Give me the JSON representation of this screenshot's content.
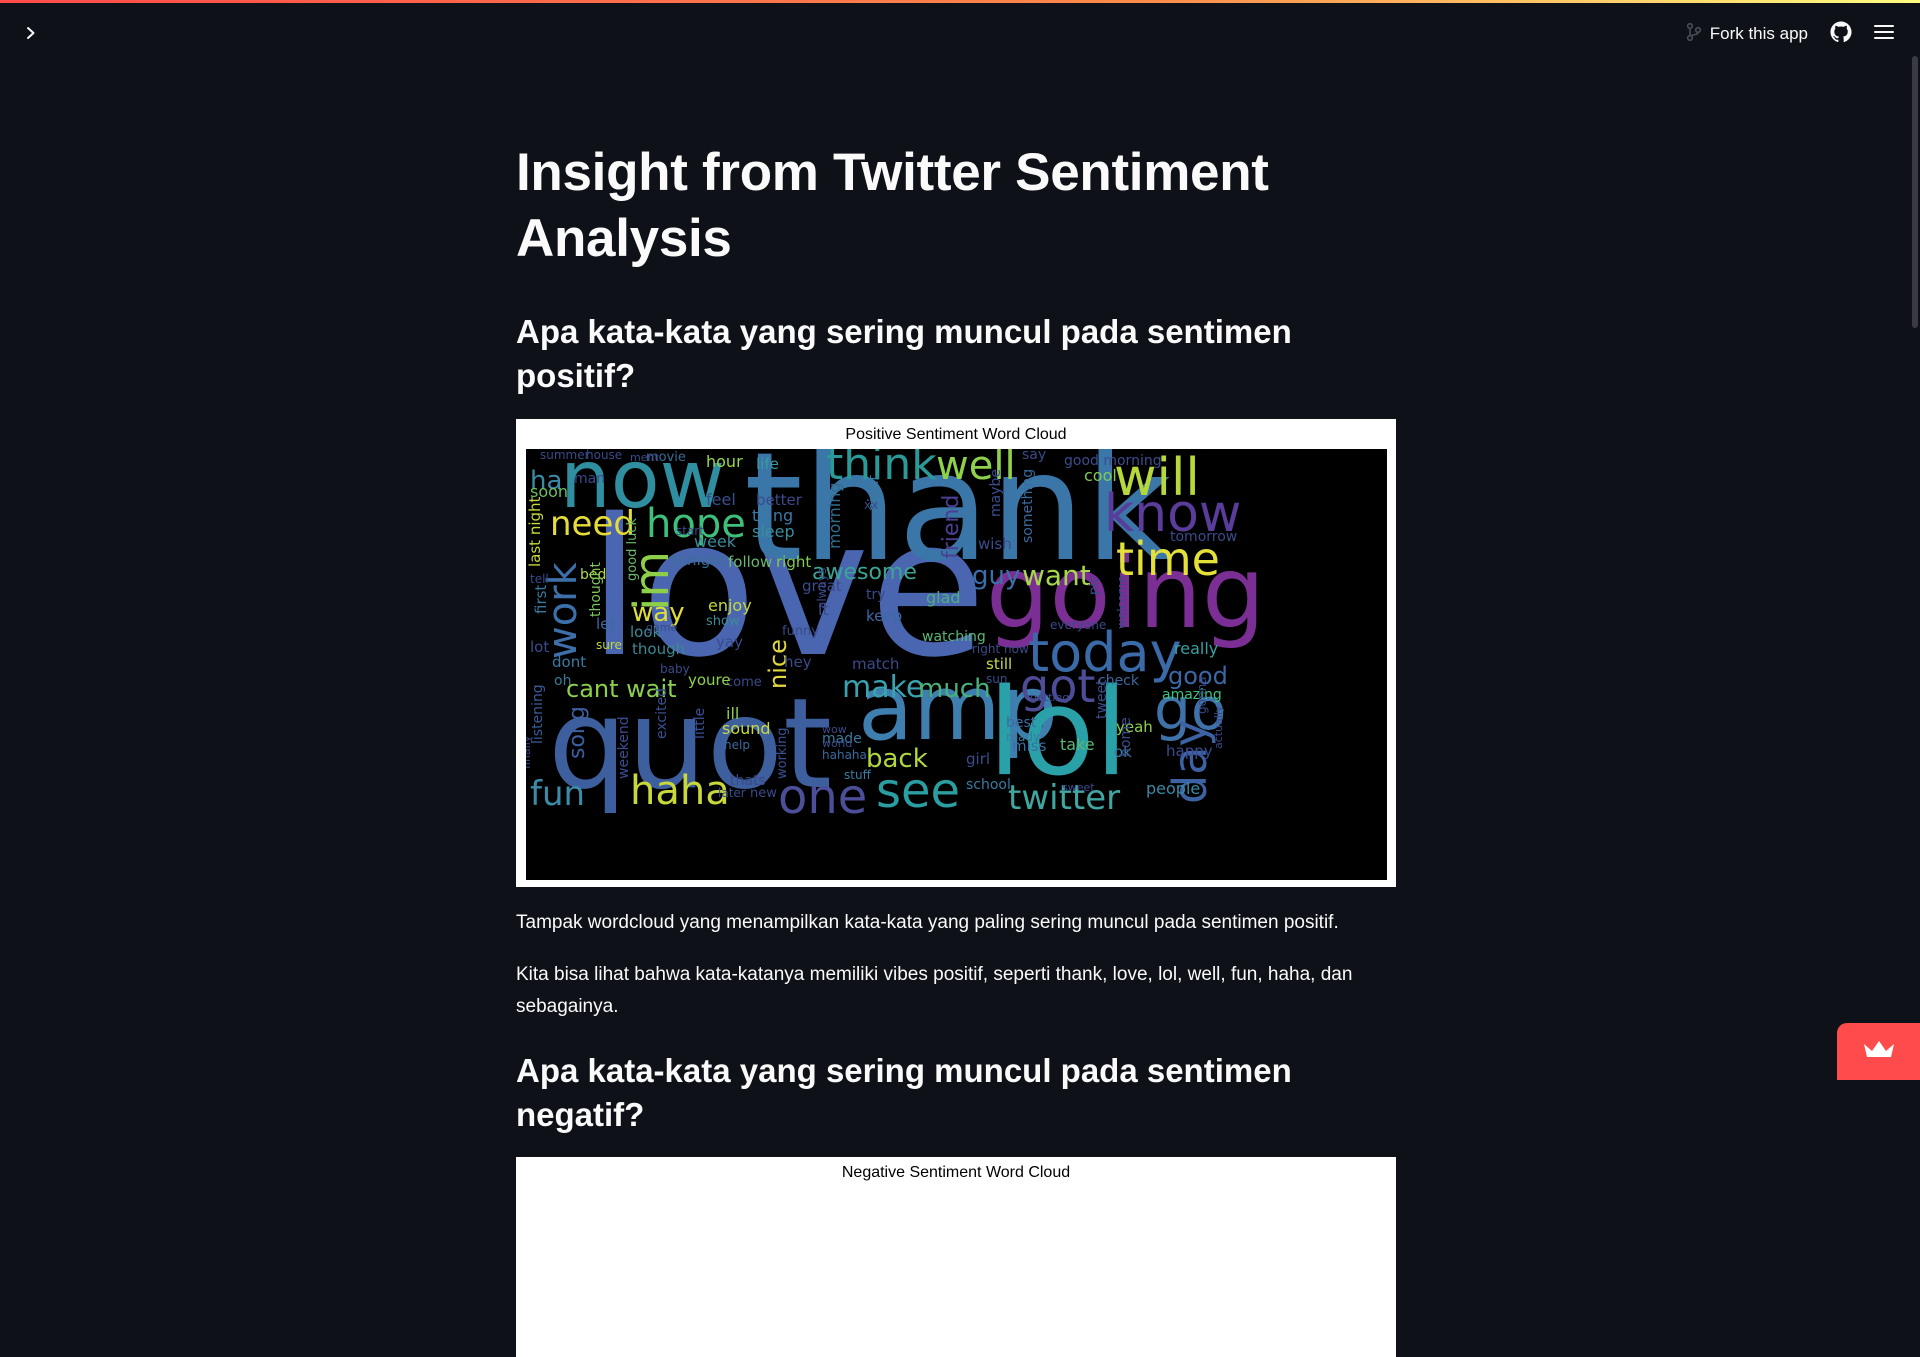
{
  "header": {
    "expand_icon": "chevron-right-icon",
    "fork_label": "Fork this app",
    "fork_icon": "fork-icon",
    "github_icon": "github-icon",
    "menu_icon": "hamburger-menu-icon"
  },
  "main": {
    "title": "Insight from Twitter Sentiment Analysis",
    "section_positive": {
      "heading": "Apa kata-kata yang sering muncul pada sentimen positif?",
      "figure_title": "Positive Sentiment Word Cloud",
      "paragraph_1": "Tampak wordcloud yang menampilkan kata-kata yang paling sering muncul pada sentimen positif.",
      "paragraph_2": "Kita bisa lihat bahwa kata-katanya memiliki vibes positif, seperti thank, love, lol, well, fun, haha, dan sebagainya."
    },
    "section_negative": {
      "heading": "Apa kata-kata yang sering muncul pada sentimen negatif?",
      "figure_title": "Negative Sentiment Word Cloud"
    }
  },
  "wordcloud_positive": [
    {
      "text": "love",
      "color": "#4a66b0"
    },
    {
      "text": "thank",
      "color": "#3b76a8"
    },
    {
      "text": "now",
      "color": "#2f8fa0"
    },
    {
      "text": "quot",
      "color": "#3e5f9e"
    },
    {
      "text": "amp",
      "color": "#3e7fb0"
    },
    {
      "text": "lol",
      "color": "#2aa0a8"
    },
    {
      "text": "going",
      "color": "#7b2f95"
    },
    {
      "text": "will",
      "color": "#b6d83a"
    },
    {
      "text": "know",
      "color": "#5a3c9a"
    },
    {
      "text": "time",
      "color": "#e3e03a"
    },
    {
      "text": "today",
      "color": "#3a6aa8"
    },
    {
      "text": "think",
      "color": "#2a9a98"
    },
    {
      "text": "well",
      "color": "#8ed14a"
    },
    {
      "text": "hope",
      "color": "#3ec07a"
    },
    {
      "text": "need",
      "color": "#e6dc38"
    },
    {
      "text": "work",
      "color": "#3d6fa8"
    },
    {
      "text": "im",
      "color": "#8ecf4a"
    },
    {
      "text": "go",
      "color": "#3f72a8"
    },
    {
      "text": "got",
      "color": "#4e4c96"
    },
    {
      "text": "see",
      "color": "#2a9ea0"
    },
    {
      "text": "one",
      "color": "#4c4e98"
    },
    {
      "text": "haha",
      "color": "#c8d83a"
    },
    {
      "text": "fun",
      "color": "#3a8aa8"
    },
    {
      "text": "twitter",
      "color": "#3fa6a0"
    },
    {
      "text": "day",
      "color": "#3d62a4"
    },
    {
      "text": "make",
      "color": "#3aa2b0"
    },
    {
      "text": "much",
      "color": "#4bb07a"
    },
    {
      "text": "back",
      "color": "#b0d640"
    },
    {
      "text": "want",
      "color": "#a8d848"
    },
    {
      "text": "awesome",
      "color": "#3ca494"
    },
    {
      "text": "cant wait",
      "color": "#8cd14e"
    },
    {
      "text": "way",
      "color": "#e0dc3a"
    },
    {
      "text": "nice",
      "color": "#e3d83a"
    },
    {
      "text": "good",
      "color": "#3b67a6"
    },
    {
      "text": "guy",
      "color": "#3a6fa8"
    },
    {
      "text": "friend",
      "color": "#4b3f92"
    },
    {
      "text": "song",
      "color": "#3b5fa0"
    },
    {
      "text": "hour",
      "color": "#9ad44a"
    },
    {
      "text": "feel",
      "color": "#3a4f8e"
    },
    {
      "text": "thing",
      "color": "#3a7aa6"
    },
    {
      "text": "sleep",
      "color": "#3a8e9e"
    },
    {
      "text": "week",
      "color": "#3d8a9a"
    },
    {
      "text": "morning",
      "color": "#2e6e8a"
    },
    {
      "text": "night",
      "color": "#3a7aa0"
    },
    {
      "text": "tonight",
      "color": "#3a7096"
    },
    {
      "text": "follow",
      "color": "#6ab86e"
    },
    {
      "text": "right",
      "color": "#7fcf50"
    },
    {
      "text": "enjoy",
      "color": "#c7d83d"
    },
    {
      "text": "show",
      "color": "#3c8a9a"
    },
    {
      "text": "sound",
      "color": "#c9d93a"
    },
    {
      "text": "really",
      "color": "#3aa0a0"
    },
    {
      "text": "still",
      "color": "#c8d84a"
    },
    {
      "text": "watching",
      "color": "#5ab874"
    },
    {
      "text": "glad",
      "color": "#4bb080"
    },
    {
      "text": "keep",
      "color": "#3b6aa6"
    },
    {
      "text": "yeah",
      "color": "#8ed24c"
    },
    {
      "text": "people",
      "color": "#3a8aa6"
    },
    {
      "text": "miss",
      "color": "#3a6ca2"
    },
    {
      "text": "take",
      "color": "#5ab874"
    },
    {
      "text": "happy",
      "color": "#3a4c90"
    },
    {
      "text": "school",
      "color": "#3a7aa0"
    },
    {
      "text": "last night",
      "color": "#c8d83a"
    },
    {
      "text": "ha",
      "color": "#3a8aa8"
    },
    {
      "text": "soon",
      "color": "#6bc060"
    },
    {
      "text": "life",
      "color": "#3a9a9e"
    },
    {
      "text": "better",
      "color": "#3a4a8c"
    },
    {
      "text": "cool",
      "color": "#7dcc58"
    },
    {
      "text": "good morning",
      "color": "#3a4e8e"
    },
    {
      "text": "tomorrow",
      "color": "#3a4a8a"
    },
    {
      "text": "wish",
      "color": "#3a4c8c"
    },
    {
      "text": "maybe",
      "color": "#3a4d8e"
    },
    {
      "text": "something",
      "color": "#3a6aa0"
    },
    {
      "text": "movie",
      "color": "#3a6a96"
    },
    {
      "text": "bed",
      "color": "#b8d84a"
    },
    {
      "text": "thought",
      "color": "#7cc45a"
    },
    {
      "text": "good luck",
      "color": "#6ab86a"
    },
    {
      "text": "look",
      "color": "#3a8e9a"
    },
    {
      "text": "though",
      "color": "#3c8894"
    },
    {
      "text": "first",
      "color": "#3a7aa0"
    },
    {
      "text": "let",
      "color": "#3a6aa6"
    },
    {
      "text": "dont",
      "color": "#3a7aa4"
    },
    {
      "text": "lot",
      "color": "#3a4c90"
    },
    {
      "text": "sure",
      "color": "#c0d840"
    },
    {
      "text": "oh",
      "color": "#3a7a9a"
    },
    {
      "text": "listening",
      "color": "#3a5c9a"
    },
    {
      "text": "excited",
      "color": "#3a4e90"
    },
    {
      "text": "little",
      "color": "#3a5096"
    },
    {
      "text": "weekend",
      "color": "#3a4e92"
    },
    {
      "text": "ill",
      "color": "#8cd04a"
    },
    {
      "text": "help",
      "color": "#3a6a9e"
    },
    {
      "text": "working",
      "color": "#3a5094"
    },
    {
      "text": "made",
      "color": "#3a7aa0"
    },
    {
      "text": "hahaha",
      "color": "#3a6a9e"
    },
    {
      "text": "stuff",
      "color": "#3a7ca4"
    },
    {
      "text": "best",
      "color": "#3a6ca2"
    },
    {
      "text": "ready",
      "color": "#3a7aa0"
    },
    {
      "text": "girl",
      "color": "#3a4c8e"
    },
    {
      "text": "ok",
      "color": "#3a7aa0"
    },
    {
      "text": "amazing",
      "color": "#3ec27c"
    },
    {
      "text": "check",
      "color": "#3a6aa0"
    },
    {
      "text": "tweet",
      "color": "#3a4e8e"
    },
    {
      "text": "home",
      "color": "#3a4c8c"
    },
    {
      "text": "everyone",
      "color": "#3a4a88"
    },
    {
      "text": "welcome",
      "color": "#3a4888"
    },
    {
      "text": "match",
      "color": "#3a4a8c"
    },
    {
      "text": "hey",
      "color": "#3a4a8a"
    },
    {
      "text": "funny",
      "color": "#3a4a8a"
    },
    {
      "text": "great",
      "color": "#3a4a8a"
    },
    {
      "text": "lt",
      "color": "#3a4a8a"
    },
    {
      "text": "try",
      "color": "#3a4a8a"
    },
    {
      "text": "yay",
      "color": "#3a4a8a"
    },
    {
      "text": "baby",
      "color": "#3a4a8a"
    },
    {
      "text": "come",
      "color": "#3a4a8a"
    },
    {
      "text": "youre",
      "color": "#8ed24a"
    },
    {
      "text": "thats",
      "color": "#3a4a8a"
    },
    {
      "text": "later",
      "color": "#3a4a8a"
    },
    {
      "text": "new",
      "color": "#3a4a8a"
    },
    {
      "text": "game",
      "color": "#3a4a8a"
    },
    {
      "text": "always",
      "color": "#3a4a8a"
    },
    {
      "text": "right now",
      "color": "#3a4a8a"
    },
    {
      "text": "getting",
      "color": "#3a4a8a"
    },
    {
      "text": "sun",
      "color": "#3a4a8a"
    },
    {
      "text": "start",
      "color": "#3a4a8a"
    },
    {
      "text": "summer",
      "color": "#3a4a8a"
    },
    {
      "text": "house",
      "color": "#3a4a8a"
    },
    {
      "text": "man",
      "color": "#3a4a8a"
    },
    {
      "text": "say",
      "color": "#3a4a8a"
    },
    {
      "text": "xx",
      "color": "#3a4a8a"
    },
    {
      "text": "pic",
      "color": "#3a4a8a"
    },
    {
      "text": "tell",
      "color": "#3a4a8a"
    },
    {
      "text": "wow",
      "color": "#3a4a8a"
    },
    {
      "text": "world",
      "color": "#3a4a8a"
    },
    {
      "text": "finally",
      "color": "#3a4a8a"
    },
    {
      "text": "sweet",
      "color": "#3a4a8a"
    },
    {
      "text": "actually",
      "color": "#3a4a8a"
    },
    {
      "text": "gonna",
      "color": "#3a4a8a"
    },
    {
      "text": "ment",
      "color": "#3a4a8a"
    }
  ]
}
